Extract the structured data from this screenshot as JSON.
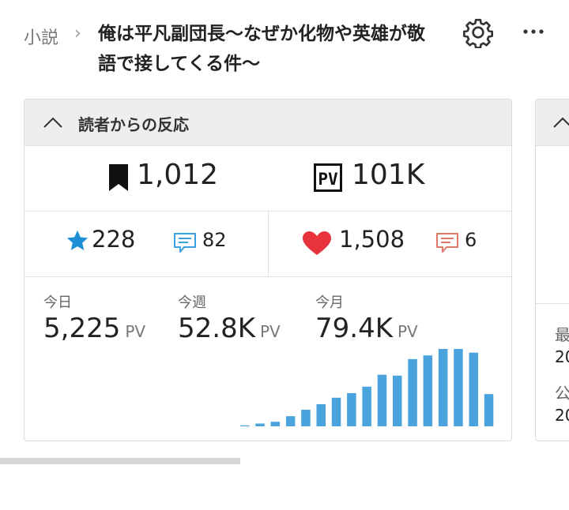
{
  "header": {
    "breadcrumb": "小説",
    "title": "俺は平凡副団長〜なぜか化物や英雄が敬語で接してくる件〜"
  },
  "reaction_card": {
    "title": "読者からの反応",
    "bookmarks": "1,012",
    "pv_badge": "PV",
    "total_pv": "101K",
    "stars": "228",
    "star_comments": "82",
    "hearts": "1,508",
    "heart_comments": "6",
    "stats": [
      {
        "label": "今日",
        "value": "5,225",
        "unit": "PV"
      },
      {
        "label": "今週",
        "value": "52.8K",
        "unit": "PV"
      },
      {
        "label": "今月",
        "value": "79.4K",
        "unit": "PV"
      }
    ]
  },
  "chart_data": {
    "type": "bar",
    "values": [
      1,
      3,
      5,
      11,
      18,
      24,
      31,
      36,
      43,
      56,
      55,
      73,
      77,
      84,
      84,
      80,
      35
    ],
    "ylim": [
      0,
      84
    ],
    "bar_color": "#4aa3dc"
  },
  "side_card": {
    "labels": [
      "最",
      "公"
    ],
    "values": [
      "20",
      "20"
    ]
  },
  "colors": {
    "accent_blue": "#1d8fd6",
    "heart_red": "#e8323c",
    "comment_red": "#e07868",
    "header_bg": "#f0eeec"
  },
  "icons": {
    "gear": "gear-icon",
    "more": "more-icon",
    "bookmark": "bookmark-icon",
    "pv": "pv-icon",
    "star": "star-icon",
    "comment": "comment-icon",
    "heart": "heart-icon",
    "collapse": "chevron-up-icon"
  }
}
